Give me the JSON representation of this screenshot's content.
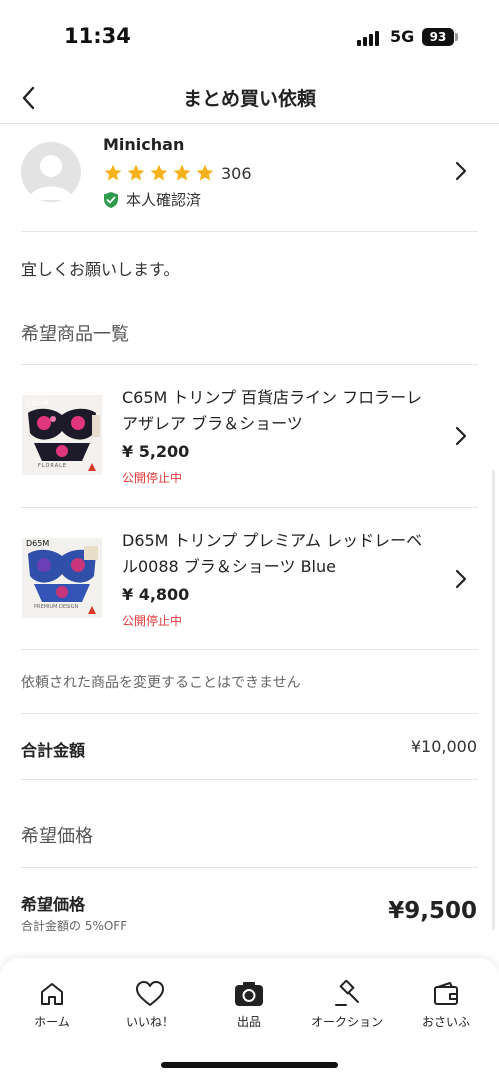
{
  "status_bar": {
    "time": "11:34",
    "network": "5G",
    "battery": "93"
  },
  "header": {
    "title": "まとめ買い依頼"
  },
  "seller": {
    "name": "Minichan",
    "rating_count": "306",
    "verified_label": "本人確認済"
  },
  "message": "宜しくお願いします。",
  "items_section_title": "希望商品一覧",
  "items": [
    {
      "title": "C65M トリンプ 百貨店ライン フロラーレ アザレア ブラ＆ショーツ",
      "price": "¥ 5,200",
      "status": "公開停止中",
      "thumb_label": "C65M",
      "thumb_caption": "FLORALE"
    },
    {
      "title": "D65M トリンプ プレミアム レッドレーベル0088 ブラ＆ショーツ Blue",
      "price": "¥ 4,800",
      "status": "公開停止中",
      "thumb_label": "D65M",
      "thumb_caption": "PREMIUM DESIGN"
    }
  ],
  "notice": "依頼された商品を変更することはできません",
  "total": {
    "label": "合計金額",
    "value": "¥10,000"
  },
  "desired_section_title": "希望価格",
  "desired_price": {
    "label": "希望価格",
    "sub": "合計金額の 5%OFF",
    "value": "¥9,500"
  },
  "tabs": [
    {
      "label": "ホーム",
      "icon": "home-icon"
    },
    {
      "label": "いいね！",
      "icon": "heart-icon"
    },
    {
      "label": "出品",
      "icon": "camera-icon"
    },
    {
      "label": "オークション",
      "icon": "gavel-icon"
    },
    {
      "label": "おさいふ",
      "icon": "wallet-icon"
    }
  ],
  "colors": {
    "star": "#f5b21c",
    "verified": "#2e9a4b",
    "status_red": "#e03a3a"
  }
}
